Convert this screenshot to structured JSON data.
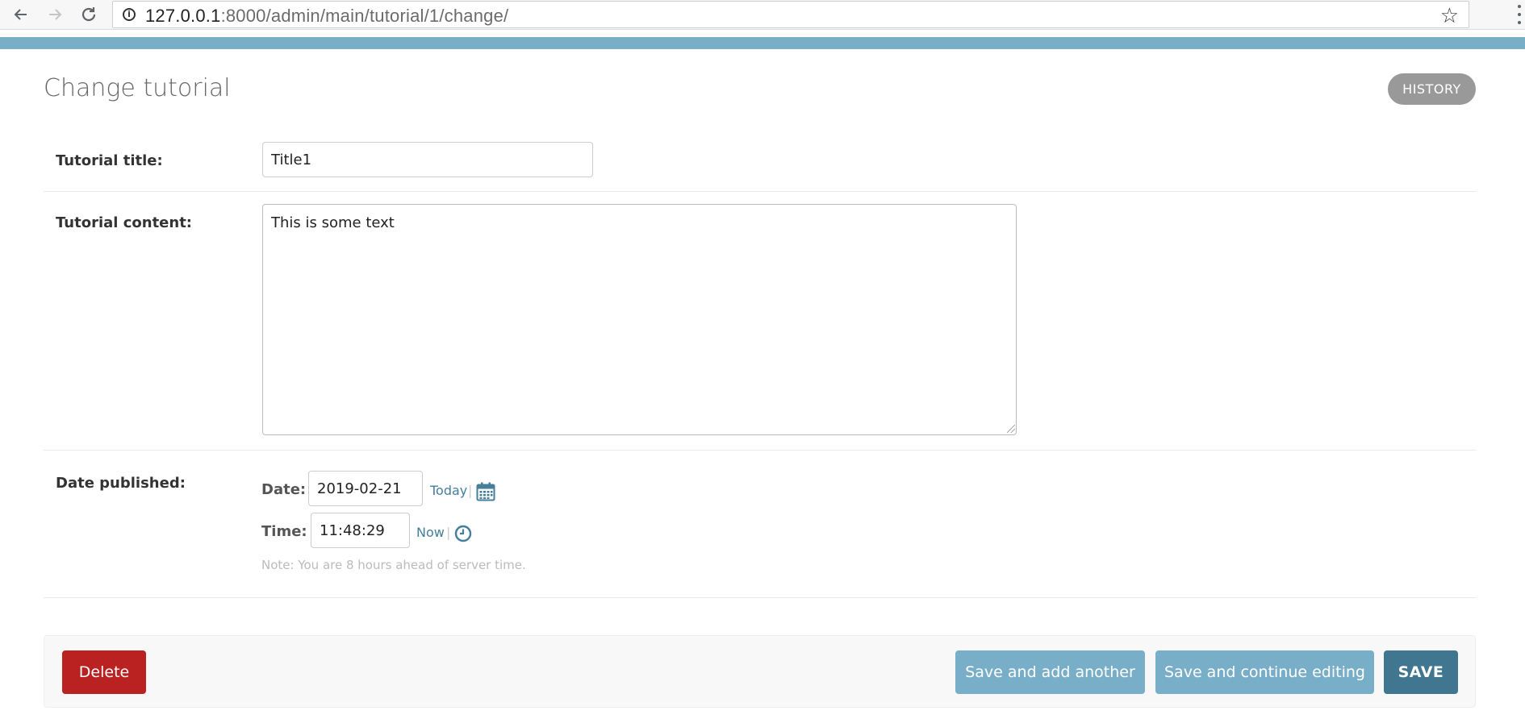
{
  "browser": {
    "url_host": "127.0.0.1",
    "url_path": ":8000/admin/main/tutorial/1/change/",
    "back_icon": "arrow-left-icon",
    "forward_icon": "arrow-right-icon",
    "reload_icon": "reload-icon",
    "star_icon": "star-icon",
    "menu_icon": "kebab-menu-icon"
  },
  "header": {
    "title": "Change tutorial",
    "history_label": "HISTORY"
  },
  "form": {
    "title_field": {
      "label": "Tutorial title:",
      "value": "Title1"
    },
    "content_field": {
      "label": "Tutorial content:",
      "value": "This is some text"
    },
    "date_published": {
      "label": "Date published:",
      "date_label": "Date:",
      "date_value": "2019-02-21",
      "today_link": "Today",
      "time_label": "Time:",
      "time_value": "11:48:29",
      "now_link": "Now",
      "separator": "|",
      "note": "Note: You are 8 hours ahead of server time."
    }
  },
  "actions": {
    "delete_label": "Delete",
    "save_add_another_label": "Save and add another",
    "save_continue_label": "Save and continue editing",
    "save_label": "SAVE"
  },
  "colors": {
    "accent": "#79aec8",
    "primary": "#417690",
    "danger": "#ba2121",
    "link": "#447e9b"
  }
}
